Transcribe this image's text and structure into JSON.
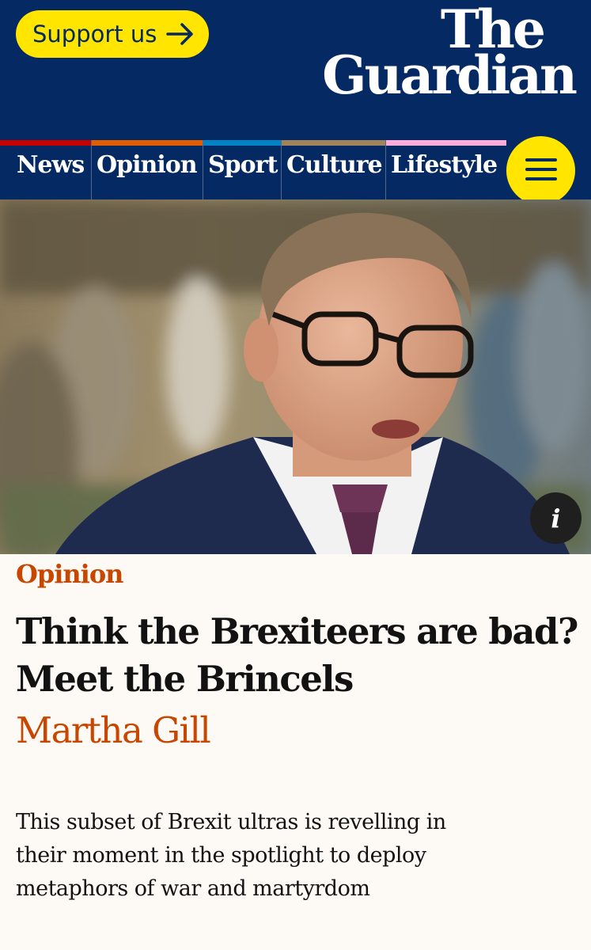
{
  "header": {
    "support_label": "Support us",
    "logo_line1": "The",
    "logo_line2": "Guardian",
    "brand_color": "#052962",
    "accent_color": "#ffe500"
  },
  "nav": {
    "items": [
      {
        "label": "News",
        "color": "#c70000"
      },
      {
        "label": "Opinion",
        "color": "#e05e00"
      },
      {
        "label": "Sport",
        "color": "#0084c6"
      },
      {
        "label": "Culture",
        "color": "#a1845c"
      },
      {
        "label": "Lifestyle",
        "color": "#ffabdb"
      }
    ],
    "menu_icon": "hamburger-icon"
  },
  "hero": {
    "info_label": "i",
    "info_icon": "info-icon"
  },
  "article": {
    "kicker": "Opinion",
    "headline": "Think the Brexiteers are bad? Meet the Brincels",
    "byline": "Martha Gill",
    "standfirst": "This subset of Brexit ultras is revelling in their moment in the spotlight to deploy metaphors of war and martyrdom",
    "accent_color": "#c74600"
  }
}
